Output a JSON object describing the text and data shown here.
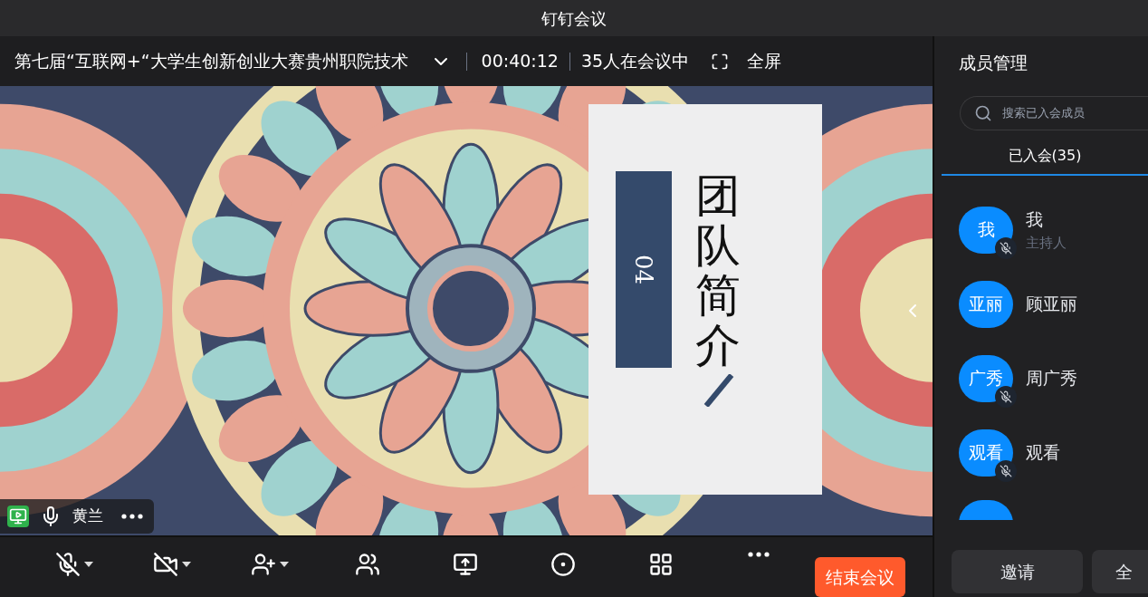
{
  "window": {
    "title": "钉钉会议"
  },
  "meeting": {
    "topic": "第七届“互联网+“大学生创新创业大赛贵州职院技术",
    "duration": "00:40:12",
    "attendance": "35人在会议中",
    "fullscreen": "全屏"
  },
  "slide": {
    "title": "团队简介",
    "number": "04"
  },
  "speaker": {
    "name": "黄兰",
    "muted": false
  },
  "toolbar": [
    {
      "kind": "mic",
      "muted": true,
      "dropdown": true
    },
    {
      "kind": "camera",
      "muted": true,
      "dropdown": true
    },
    {
      "kind": "invite",
      "dropdown": true
    },
    {
      "kind": "members",
      "dropdown": false
    },
    {
      "kind": "share",
      "dropdown": false
    },
    {
      "kind": "record",
      "dropdown": false
    },
    {
      "kind": "layout",
      "dropdown": false
    },
    {
      "kind": "more",
      "dropdown": false
    }
  ],
  "end_button": "结束会议",
  "panel": {
    "title": "成员管理",
    "search": {
      "placeholder": "搜索已入会成员"
    },
    "tabs": [
      {
        "label": "已入会(35)",
        "selected": true
      }
    ],
    "members": [
      {
        "avatar": "我",
        "name": "我",
        "role": "主持人",
        "muted": true
      },
      {
        "avatar": "亚丽",
        "name": "顾亚丽",
        "muted": false
      },
      {
        "avatar": "广秀",
        "name": "周广秀",
        "muted": true
      },
      {
        "avatar": "观看",
        "name": "观看",
        "muted": true
      }
    ],
    "buttons": [
      "邀请",
      "全"
    ]
  }
}
